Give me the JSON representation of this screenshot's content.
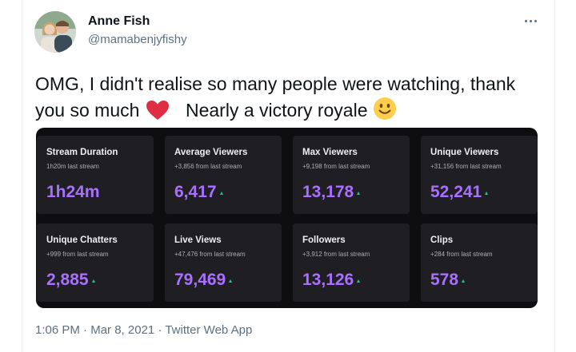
{
  "user": {
    "name": "Anne Fish",
    "handle": "@mamabenjyfishy"
  },
  "tweet": {
    "text_part1": "OMG, I didn't realise so many people were watching, thank you so much",
    "text_part2": "Nearly a victory royale"
  },
  "stats": [
    {
      "title": "Stream Duration",
      "sub": "1h20m last stream",
      "value": "1h24m",
      "up": false
    },
    {
      "title": "Average Viewers",
      "sub": "+3,856 from last stream",
      "value": "6,417",
      "up": true
    },
    {
      "title": "Max Viewers",
      "sub": "+9,198 from last stream",
      "value": "13,178",
      "up": true
    },
    {
      "title": "Unique Viewers",
      "sub": "+31,156 from last stream",
      "value": "52,241",
      "up": true
    },
    {
      "title": "Unique Chatters",
      "sub": "+999 from last stream",
      "value": "2,885",
      "up": true
    },
    {
      "title": "Live Views",
      "sub": "+47,476 from last stream",
      "value": "79,469",
      "up": true
    },
    {
      "title": "Followers",
      "sub": "+3,912 from last stream",
      "value": "13,126",
      "up": true
    },
    {
      "title": "Clips",
      "sub": "+284 from last stream",
      "value": "578",
      "up": true
    }
  ],
  "meta": {
    "time": "1:06 PM",
    "separator": "·",
    "date": "Mar 8, 2021",
    "source": "Twitter Web App"
  },
  "colors": {
    "accent": "#a970ff",
    "trend_up": "#00db84",
    "panel_bg": "#0e0e10",
    "tile_bg": "#1f1f23",
    "heart": "#e0245e"
  }
}
